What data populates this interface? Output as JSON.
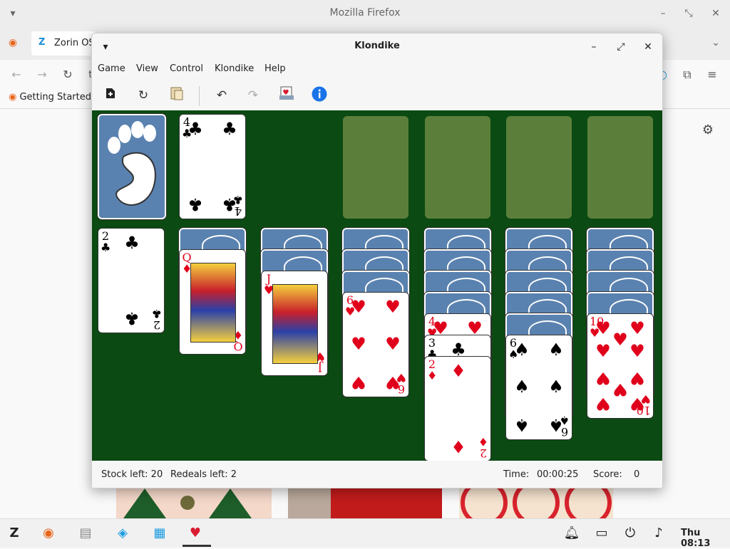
{
  "firefox": {
    "window_title": "Mozilla Firefox",
    "tab_label": "Zorin OS",
    "bookmark_label": "Getting Started",
    "url_fragment": "t"
  },
  "klondike": {
    "title": "Klondike",
    "menu": [
      "Game",
      "View",
      "Control",
      "Klondike",
      "Help"
    ],
    "toolbar": {
      "new_game": "new-game-icon",
      "restart": "restart-icon",
      "select_game": "select-game-icon",
      "undo": "undo-icon",
      "redo": "redo-icon",
      "deal": "deal-icon",
      "info": "info-icon"
    },
    "status": {
      "stock_left": "Stock left: 20",
      "redeals_left": "Redeals left: 2",
      "time_label": "Time:",
      "time_value": "00:00:25",
      "score_label": "Score:",
      "score_value": "0"
    },
    "waste_top": {
      "rank": "4",
      "suit": "♣",
      "color": "black"
    },
    "tableau": [
      {
        "hidden": 0,
        "visible": [
          {
            "rank": "2",
            "suit": "♣",
            "color": "black"
          }
        ]
      },
      {
        "hidden": 1,
        "visible": [
          {
            "rank": "Q",
            "suit": "♦",
            "color": "red",
            "face": true
          }
        ]
      },
      {
        "hidden": 2,
        "visible": [
          {
            "rank": "J",
            "suit": "♥",
            "color": "red",
            "face": true
          }
        ]
      },
      {
        "hidden": 3,
        "visible": [
          {
            "rank": "6",
            "suit": "♥",
            "color": "red"
          }
        ]
      },
      {
        "hidden": 4,
        "visible": [
          {
            "rank": "4",
            "suit": "♥",
            "color": "red"
          },
          {
            "rank": "3",
            "suit": "♣",
            "color": "black"
          },
          {
            "rank": "2",
            "suit": "♦",
            "color": "red"
          }
        ]
      },
      {
        "hidden": 5,
        "visible": [
          {
            "rank": "6",
            "suit": "♠",
            "color": "black"
          }
        ]
      },
      {
        "hidden": 4,
        "visible": [
          {
            "rank": "10",
            "suit": "♥",
            "color": "red"
          }
        ]
      }
    ]
  },
  "taskbar": {
    "clock": "Thu 08:13",
    "apps": [
      "zorin-menu-icon",
      "firefox-icon",
      "files-icon",
      "software-icon",
      "store-icon",
      "solitaire-icon"
    ],
    "tray": [
      "notification-icon",
      "display-icon",
      "power-icon",
      "volume-icon"
    ]
  }
}
